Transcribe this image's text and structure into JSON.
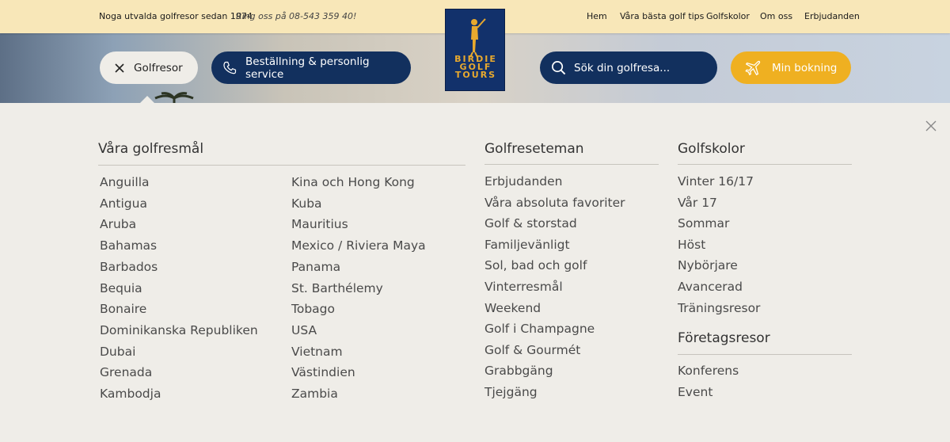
{
  "topbar": {
    "tagline": "Noga utvalda golfresor sedan 1974",
    "phone": "Ring oss på 08-543 359 40!",
    "nav": [
      "Hem",
      "Våra bästa golf tips",
      "Golfskolor",
      "Om oss",
      "Erbjudanden"
    ]
  },
  "logo": {
    "line1": "BIRDIE",
    "line2": "GOLF",
    "line3": "TOURS"
  },
  "actions": {
    "golfresor": "Golfresor",
    "service": "Beställning & personlig service",
    "search_placeholder": "Sök din golfresa...",
    "booking": "Min bokning"
  },
  "menu": {
    "destinations": {
      "title": "Våra golfresmål",
      "col1": [
        "Anguilla",
        "Antigua",
        "Aruba",
        "Bahamas",
        "Barbados",
        "Bequia",
        "Bonaire",
        "Dominikanska Republiken",
        "Dubai",
        "Grenada",
        "Kambodja"
      ],
      "col2": [
        "Kina och Hong Kong",
        "Kuba",
        "Mauritius",
        "Mexico / Riviera Maya",
        "Panama",
        "St. Barthélemy",
        "Tobago",
        "USA",
        "Vietnam",
        "Västindien",
        "Zambia"
      ]
    },
    "themes": {
      "title": "Golfreseteman",
      "items": [
        "Erbjudanden",
        "Våra absoluta favoriter",
        "Golf & storstad",
        "Familjevänligt",
        "Sol, bad och golf",
        "Vinterresmål",
        "Weekend",
        "Golf i Champagne",
        "Golf & Gourmét",
        "Grabbgäng",
        "Tjejgäng"
      ]
    },
    "schools": {
      "title": "Golfskolor",
      "items": [
        "Vinter 16/17",
        "Vår 17",
        "Sommar",
        "Höst",
        "Nybörjare",
        "Avancerad",
        "Träningsresor"
      ]
    },
    "corporate": {
      "title": "Företagsresor",
      "items": [
        "Konferens",
        "Event"
      ]
    }
  },
  "colors": {
    "navy": "#12305e",
    "gold": "#efb021",
    "topbar": "#f8e7b8",
    "panel": "#efede8"
  }
}
